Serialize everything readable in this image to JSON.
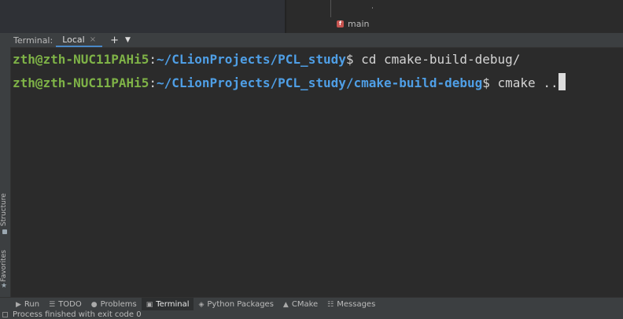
{
  "editor": {
    "breadcrumb_icon": "f",
    "breadcrumb": "main"
  },
  "terminal": {
    "title": "Terminal:",
    "tab_label": "Local",
    "tab_close": "×",
    "add": "+",
    "dropdown": "⌄",
    "lines": [
      {
        "user": "zth@zth-NUC11PAHi5",
        "sep": ":",
        "path": "~/CLionProjects/PCL_study",
        "cmd": "$ cd cmake-build-debug/"
      },
      {
        "user": "zth@zth-NUC11PAHi5",
        "sep": ":",
        "path": "~/CLionProjects/PCL_study/cmake-build-debug",
        "cmd": "$ cmake .."
      }
    ]
  },
  "side_panel": {
    "structure": "Structure",
    "favorites": "Favorites"
  },
  "bottom_tabs": [
    {
      "label": "Run",
      "icon": "run-icon"
    },
    {
      "label": "TODO",
      "icon": "todo-icon"
    },
    {
      "label": "Problems",
      "icon": "problems-icon"
    },
    {
      "label": "Terminal",
      "icon": "terminal-icon"
    },
    {
      "label": "Python Packages",
      "icon": "packages-icon"
    },
    {
      "label": "CMake",
      "icon": "cmake-icon"
    },
    {
      "label": "Messages",
      "icon": "messages-icon"
    }
  ],
  "status": {
    "message": "Process finished with exit code 0"
  },
  "colors": {
    "user": "#7fb347",
    "path": "#4f9fe6",
    "active_tab_underline": "#4a88c7"
  }
}
